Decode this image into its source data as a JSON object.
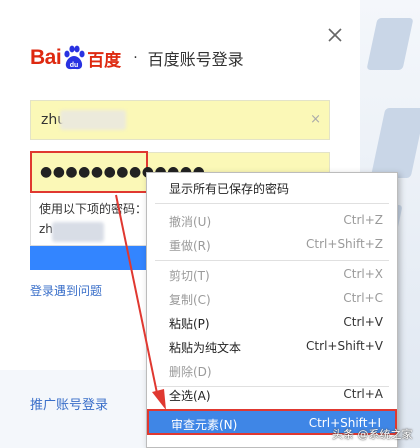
{
  "dialog": {
    "logo_bai": "Bai",
    "logo_du": "du",
    "logo_cn": "百度",
    "logo_dot": "·",
    "title": "百度账号登录",
    "close_glyph": "✕",
    "username_value": "zhu",
    "clear_glyph": "×",
    "password_dots": "●●●●●●●●●●●●●",
    "suggest_title": "使用以下项的密码：",
    "suggest_item": "zh",
    "help_link": "登录遇到问题",
    "promo_link": "推广账号登录"
  },
  "context_menu": {
    "items": [
      {
        "label": "显示所有已保存的密码",
        "key": "",
        "disabled": false
      },
      {
        "label": "撤消(U)",
        "key": "Ctrl+Z",
        "disabled": true
      },
      {
        "label": "重做(R)",
        "key": "Ctrl+Shift+Z",
        "disabled": true
      },
      {
        "label": "剪切(T)",
        "key": "Ctrl+X",
        "disabled": true
      },
      {
        "label": "复制(C)",
        "key": "Ctrl+C",
        "disabled": true
      },
      {
        "label": "粘贴(P)",
        "key": "Ctrl+V",
        "disabled": false
      },
      {
        "label": "粘贴为纯文本",
        "key": "Ctrl+Shift+V",
        "disabled": false
      },
      {
        "label": "删除(D)",
        "key": "",
        "disabled": true
      },
      {
        "label": "全选(A)",
        "key": "Ctrl+A",
        "disabled": false
      },
      {
        "label": "审查元素(N)",
        "key": "Ctrl+Shift+I",
        "disabled": false
      }
    ]
  },
  "watermark": "头条 @系统之家",
  "colors": {
    "baidu_red": "#de2910",
    "baidu_blue": "#2932e1",
    "autofill_yellow": "#fbf8b7",
    "highlight_red": "#e03830",
    "menu_selected_blue": "#3f86e6",
    "link_blue": "#3a6fc9"
  }
}
